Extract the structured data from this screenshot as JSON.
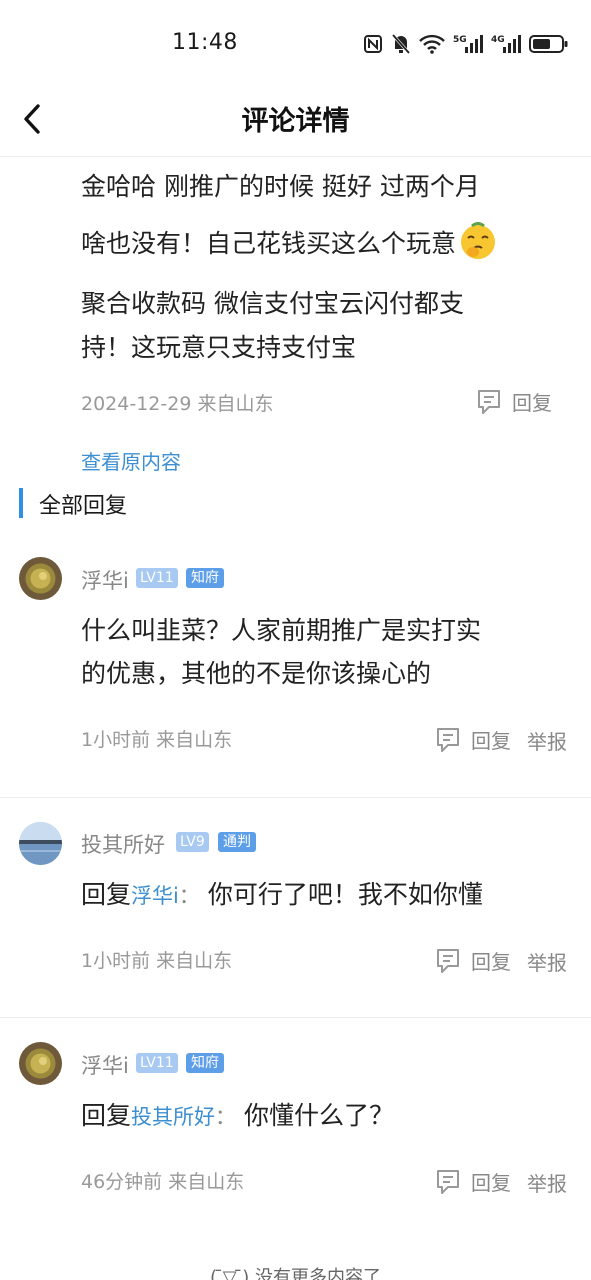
{
  "status_bar": {
    "time": "11:48",
    "icons": [
      "nfc-icon",
      "mute-bell-icon",
      "wifi-icon",
      "5g-signal-icon",
      "4g-signal-icon",
      "battery-icon"
    ],
    "signal_5g": "5G",
    "signal_4g": "4G"
  },
  "header": {
    "title": "评论详情",
    "back_icon": "chevron-left-icon"
  },
  "original_comment": {
    "lines": [
      "金哈哈  刚推广的时候 挺好 过两个月",
      "啥也没有！自己花钱买这么个玩意",
      "聚合收款码  微信支付宝云闪付都支",
      "持！这玩意只支持支付宝"
    ],
    "emoji": "thinking-emoji",
    "meta": "2024-12-29 来自山东",
    "reply_label": "回复"
  },
  "view_original": "查看原内容",
  "section_title": "全部回复",
  "replies": [
    {
      "username": "浮华i",
      "level": "LV11",
      "title": "知府",
      "text_lines": [
        "什么叫韭菜？人家前期推广是实打实",
        "的优惠，其他的不是你该操心的"
      ],
      "meta": "1小时前 来自山东",
      "reply_label": "回复",
      "report_label": "举报"
    },
    {
      "username": "投其所好",
      "level": "LV9",
      "title": "通判",
      "reply_prefix": "回复",
      "mention": "浮华i",
      "separator": "：",
      "text": "你可行了吧！我不如你懂",
      "meta": "1小时前 来自山东",
      "reply_label": "回复",
      "report_label": "举报"
    },
    {
      "username": "浮华i",
      "level": "LV11",
      "title": "知府",
      "reply_prefix": "回复",
      "mention": "投其所好",
      "separator": "：",
      "text": "你懂什么了？",
      "meta": "46分钟前 来自山东",
      "reply_label": "回复",
      "report_label": "举报"
    }
  ],
  "footer": {
    "no_more": "( ̄▽ ̄) 没有更多内容了"
  },
  "colors": {
    "accent": "#2f8fe0",
    "link": "#3d8fd1",
    "level_badge": "#a7c9f2",
    "title_badge": "#5d9ee9",
    "meta_gray": "#999999"
  }
}
